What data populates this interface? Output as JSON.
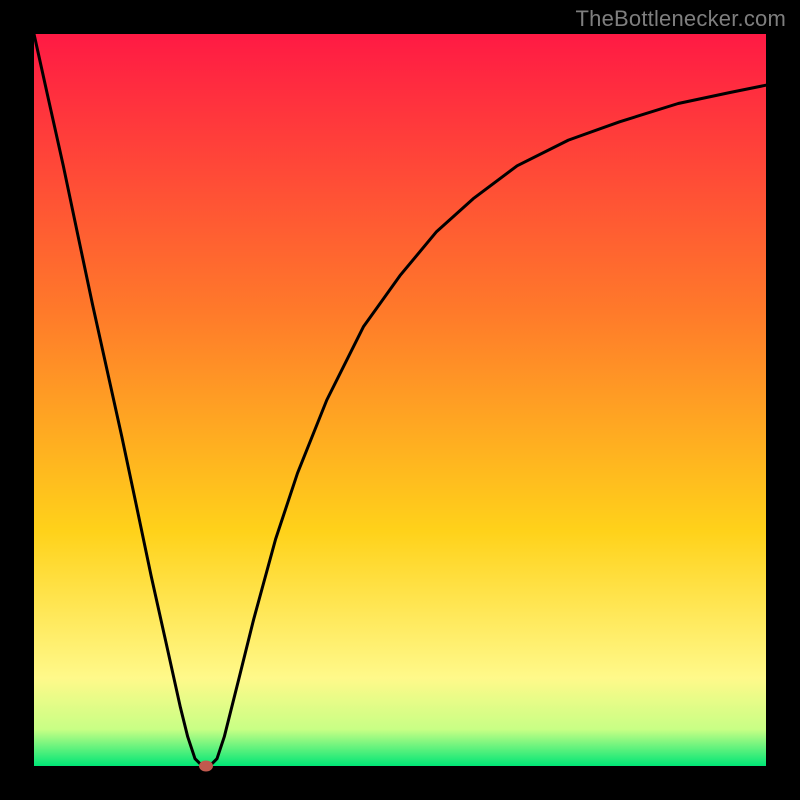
{
  "attribution": "TheBottlenecker.com",
  "colors": {
    "frame": "#000000",
    "gradient_top": "#ff1a44",
    "gradient_mid1": "#ff7a2a",
    "gradient_mid2": "#ffd21a",
    "gradient_low": "#fff98a",
    "gradient_bottom1": "#c8ff85",
    "gradient_bottom2": "#00e676",
    "curve": "#000000",
    "marker": "#c1594e"
  },
  "chart_data": {
    "type": "line",
    "title": "",
    "xlabel": "",
    "ylabel": "",
    "xlim": [
      0,
      100
    ],
    "ylim": [
      0,
      100
    ],
    "series": [
      {
        "name": "bottleneck-curve",
        "x": [
          0,
          2,
          4,
          6,
          8,
          10,
          12,
          14,
          16,
          18,
          20,
          21,
          22,
          23,
          24,
          25,
          26,
          28,
          30,
          33,
          36,
          40,
          45,
          50,
          55,
          60,
          66,
          73,
          80,
          88,
          95,
          100
        ],
        "y": [
          100,
          91,
          82,
          72.5,
          63,
          54,
          45,
          35.5,
          26,
          17,
          8,
          4,
          1,
          0,
          0,
          1,
          4,
          12,
          20,
          31,
          40,
          50,
          60,
          67,
          73,
          77.5,
          82,
          85.5,
          88,
          90.5,
          92,
          93
        ]
      }
    ],
    "marker": {
      "x": 23.5,
      "y": 0
    },
    "annotations": []
  }
}
